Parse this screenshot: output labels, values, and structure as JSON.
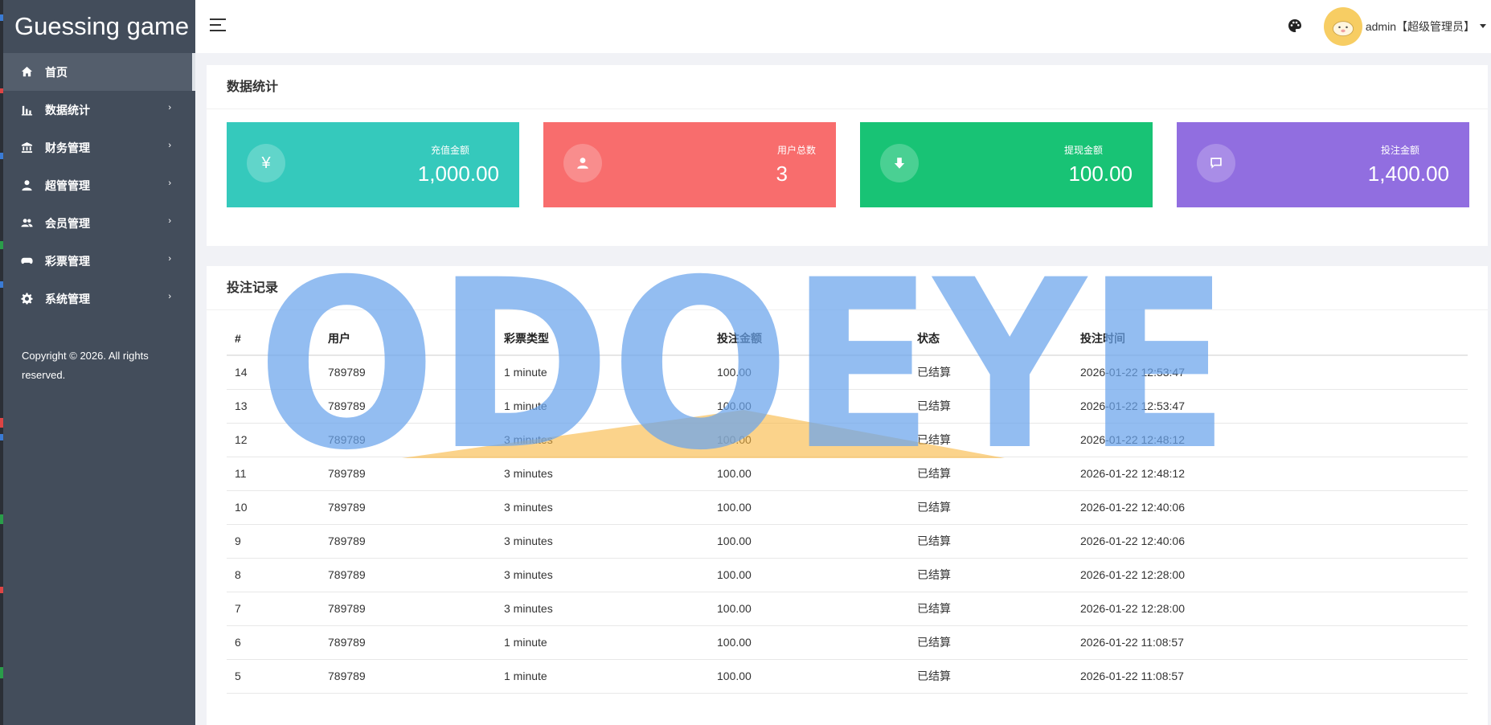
{
  "app": {
    "title": "Guessing game"
  },
  "sidebar": {
    "items": [
      {
        "label": "首页",
        "icon": "home-icon",
        "active": true
      },
      {
        "label": "数据统计",
        "icon": "bar-chart-icon",
        "arrow": "›"
      },
      {
        "label": "财务管理",
        "icon": "bank-icon",
        "arrow": "›"
      },
      {
        "label": "超管管理",
        "icon": "user-icon",
        "arrow": "›"
      },
      {
        "label": "会员管理",
        "icon": "users-icon",
        "arrow": "›"
      },
      {
        "label": "彩票管理",
        "icon": "gamepad-icon",
        "arrow": "›"
      },
      {
        "label": "系统管理",
        "icon": "gear-icon",
        "arrow": "›"
      }
    ],
    "copyright": "Copyright © 2026. All rights reserved."
  },
  "header": {
    "user_label": "admin【超级管理员】",
    "icons": [
      "menu-icon",
      "palette-icon",
      "avatar"
    ]
  },
  "stats": {
    "title": "数据统计",
    "cards": [
      {
        "label": "充值金额",
        "value": "1,000.00",
        "icon": "yen-icon",
        "color": "#35c9bc"
      },
      {
        "label": "用户总数",
        "value": "3",
        "icon": "user-icon",
        "color": "#f86d6d"
      },
      {
        "label": "提现金额",
        "value": "100.00",
        "icon": "arrow-down-icon",
        "color": "#18c375"
      },
      {
        "label": "投注金额",
        "value": "1,400.00",
        "icon": "comment-icon",
        "color": "#916ee0"
      }
    ]
  },
  "records": {
    "title": "投注记录",
    "columns": [
      "#",
      "用户",
      "彩票类型",
      "投注金额",
      "状态",
      "投注时间"
    ],
    "rows": [
      [
        "14",
        "789789",
        "1 minute",
        "100.00",
        "已结算",
        "2026-01-22 12:53:47"
      ],
      [
        "13",
        "789789",
        "1 minute",
        "100.00",
        "已结算",
        "2026-01-22 12:53:47"
      ],
      [
        "12",
        "789789",
        "3 minutes",
        "100.00",
        "已结算",
        "2026-01-22 12:48:12"
      ],
      [
        "11",
        "789789",
        "3 minutes",
        "100.00",
        "已结算",
        "2026-01-22 12:48:12"
      ],
      [
        "10",
        "789789",
        "3 minutes",
        "100.00",
        "已结算",
        "2026-01-22 12:40:06"
      ],
      [
        "9",
        "789789",
        "3 minutes",
        "100.00",
        "已结算",
        "2026-01-22 12:40:06"
      ],
      [
        "8",
        "789789",
        "3 minutes",
        "100.00",
        "已结算",
        "2026-01-22 12:28:00"
      ],
      [
        "7",
        "789789",
        "3 minutes",
        "100.00",
        "已结算",
        "2026-01-22 12:28:00"
      ],
      [
        "6",
        "789789",
        "1 minute",
        "100.00",
        "已结算",
        "2026-01-22 11:08:57"
      ],
      [
        "5",
        "789789",
        "1 minute",
        "100.00",
        "已结算",
        "2026-01-22 11:08:57"
      ]
    ]
  },
  "watermark": {
    "text": "ODOEYE",
    "color": "#6aa3ec",
    "accent": "#f9b53d"
  }
}
